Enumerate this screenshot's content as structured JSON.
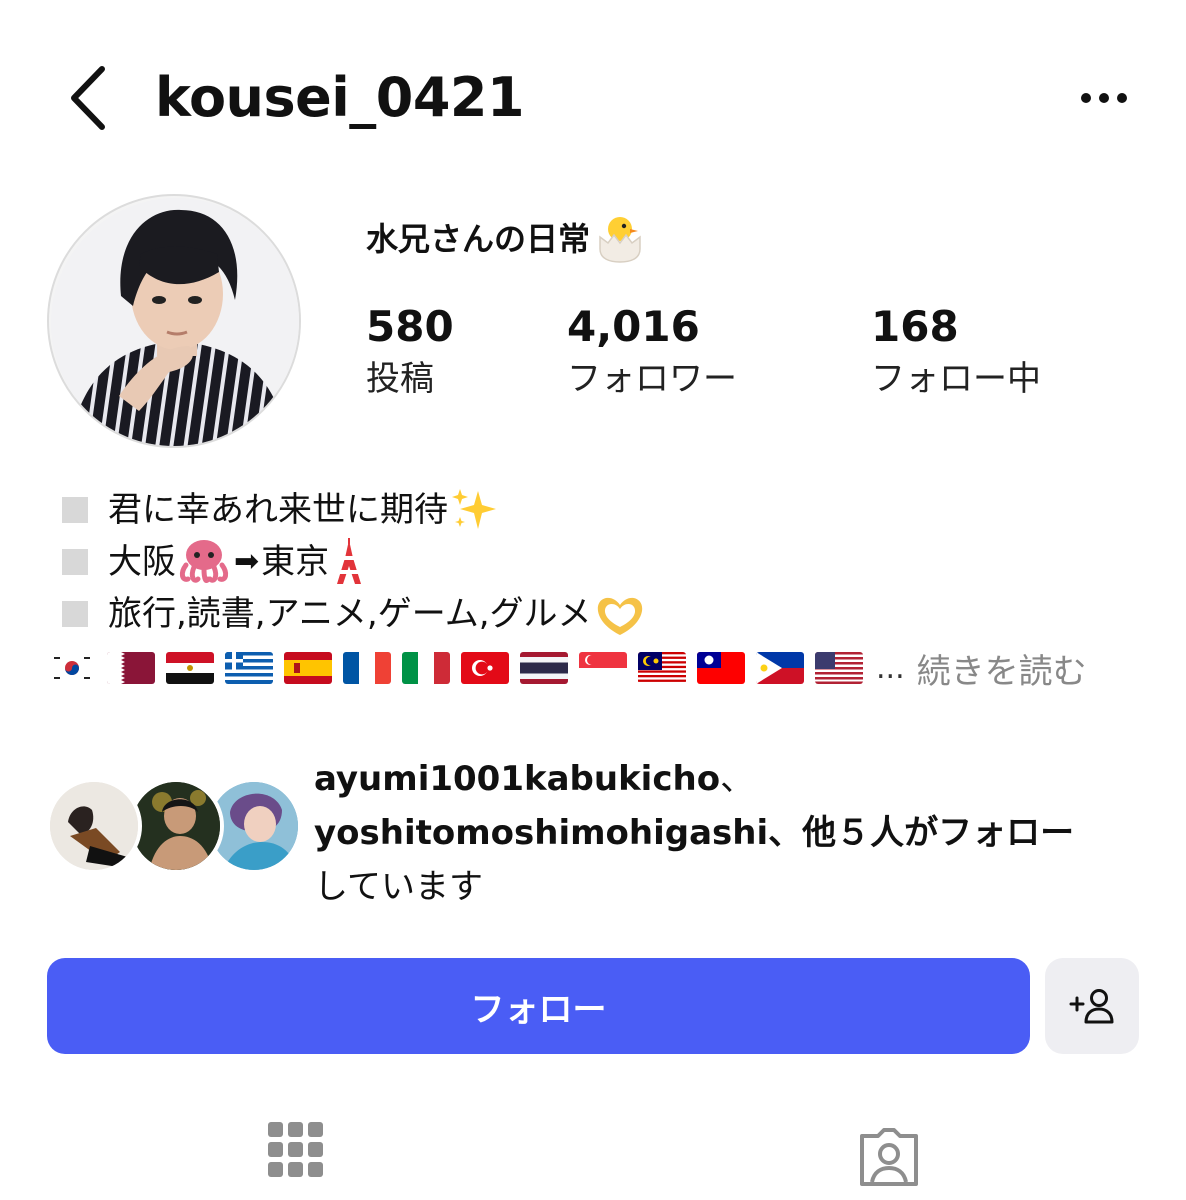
{
  "header": {
    "username": "kousei_0421",
    "back_icon": "chevron-left-icon",
    "more_icon": "more-horizontal-icon"
  },
  "profile": {
    "display_name": "水兄さんの日常",
    "display_name_emoji": "hatching-chick-emoji",
    "stats": [
      {
        "value": "580",
        "label": "投稿"
      },
      {
        "value": "4,016",
        "label": "フォロワー"
      },
      {
        "value": "168",
        "label": "フォロー中"
      }
    ]
  },
  "bio": {
    "lines": [
      {
        "text": "君に幸あれ来世に期待",
        "emoji_after": "sparkles-emoji"
      },
      {
        "text_a": "大阪",
        "emoji_a": "octopus-emoji",
        "arrow": "➡",
        "text_b": "東京",
        "emoji_b": "tokyo-tower-emoji"
      },
      {
        "text": "旅行,読書,アニメ,ゲーム,グルメ",
        "emoji_after": "heart-hands-emoji"
      }
    ],
    "flags": [
      "South Korea",
      "Qatar",
      "Egypt",
      "Greece",
      "Spain",
      "France",
      "Italy",
      "Turkey",
      "Thailand",
      "Singapore",
      "Malaysia",
      "Taiwan",
      "Philippines",
      "United States"
    ],
    "ellipsis": "...",
    "more_label": "続きを読む"
  },
  "mutual": {
    "user1": "ayumi1001kabukicho",
    "sep1": "、",
    "user2": "yoshitomoshimohigashi",
    "suffix": "、他５人がフォロー",
    "line3": "しています"
  },
  "actions": {
    "follow_label": "フォロー",
    "suggest_icon": "add-person-icon"
  },
  "tabs": [
    {
      "icon": "grid-icon"
    },
    {
      "icon": "tagged-person-icon"
    }
  ],
  "colors": {
    "primary": "#4a5df5",
    "secondary_button": "#eeeef2",
    "muted_text": "#888888",
    "tab_icon": "#8e8e8e"
  }
}
